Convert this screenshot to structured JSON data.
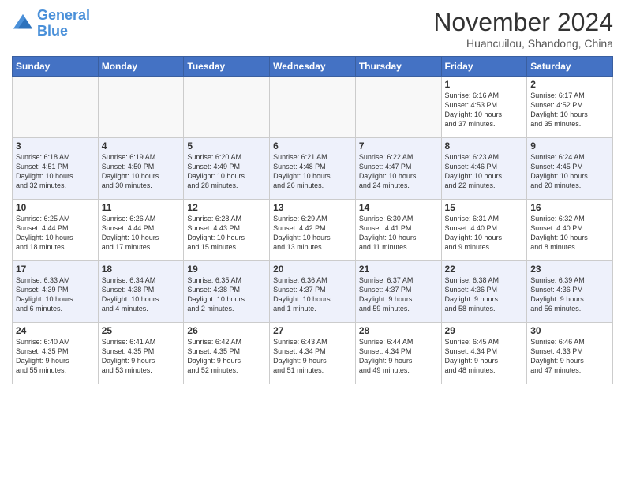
{
  "header": {
    "logo_line1": "General",
    "logo_line2": "Blue",
    "month_title": "November 2024",
    "subtitle": "Huancuilou, Shandong, China"
  },
  "days_of_week": [
    "Sunday",
    "Monday",
    "Tuesday",
    "Wednesday",
    "Thursday",
    "Friday",
    "Saturday"
  ],
  "weeks": [
    [
      {
        "day": "",
        "info": ""
      },
      {
        "day": "",
        "info": ""
      },
      {
        "day": "",
        "info": ""
      },
      {
        "day": "",
        "info": ""
      },
      {
        "day": "",
        "info": ""
      },
      {
        "day": "1",
        "info": "Sunrise: 6:16 AM\nSunset: 4:53 PM\nDaylight: 10 hours\nand 37 minutes."
      },
      {
        "day": "2",
        "info": "Sunrise: 6:17 AM\nSunset: 4:52 PM\nDaylight: 10 hours\nand 35 minutes."
      }
    ],
    [
      {
        "day": "3",
        "info": "Sunrise: 6:18 AM\nSunset: 4:51 PM\nDaylight: 10 hours\nand 32 minutes."
      },
      {
        "day": "4",
        "info": "Sunrise: 6:19 AM\nSunset: 4:50 PM\nDaylight: 10 hours\nand 30 minutes."
      },
      {
        "day": "5",
        "info": "Sunrise: 6:20 AM\nSunset: 4:49 PM\nDaylight: 10 hours\nand 28 minutes."
      },
      {
        "day": "6",
        "info": "Sunrise: 6:21 AM\nSunset: 4:48 PM\nDaylight: 10 hours\nand 26 minutes."
      },
      {
        "day": "7",
        "info": "Sunrise: 6:22 AM\nSunset: 4:47 PM\nDaylight: 10 hours\nand 24 minutes."
      },
      {
        "day": "8",
        "info": "Sunrise: 6:23 AM\nSunset: 4:46 PM\nDaylight: 10 hours\nand 22 minutes."
      },
      {
        "day": "9",
        "info": "Sunrise: 6:24 AM\nSunset: 4:45 PM\nDaylight: 10 hours\nand 20 minutes."
      }
    ],
    [
      {
        "day": "10",
        "info": "Sunrise: 6:25 AM\nSunset: 4:44 PM\nDaylight: 10 hours\nand 18 minutes."
      },
      {
        "day": "11",
        "info": "Sunrise: 6:26 AM\nSunset: 4:44 PM\nDaylight: 10 hours\nand 17 minutes."
      },
      {
        "day": "12",
        "info": "Sunrise: 6:28 AM\nSunset: 4:43 PM\nDaylight: 10 hours\nand 15 minutes."
      },
      {
        "day": "13",
        "info": "Sunrise: 6:29 AM\nSunset: 4:42 PM\nDaylight: 10 hours\nand 13 minutes."
      },
      {
        "day": "14",
        "info": "Sunrise: 6:30 AM\nSunset: 4:41 PM\nDaylight: 10 hours\nand 11 minutes."
      },
      {
        "day": "15",
        "info": "Sunrise: 6:31 AM\nSunset: 4:40 PM\nDaylight: 10 hours\nand 9 minutes."
      },
      {
        "day": "16",
        "info": "Sunrise: 6:32 AM\nSunset: 4:40 PM\nDaylight: 10 hours\nand 8 minutes."
      }
    ],
    [
      {
        "day": "17",
        "info": "Sunrise: 6:33 AM\nSunset: 4:39 PM\nDaylight: 10 hours\nand 6 minutes."
      },
      {
        "day": "18",
        "info": "Sunrise: 6:34 AM\nSunset: 4:38 PM\nDaylight: 10 hours\nand 4 minutes."
      },
      {
        "day": "19",
        "info": "Sunrise: 6:35 AM\nSunset: 4:38 PM\nDaylight: 10 hours\nand 2 minutes."
      },
      {
        "day": "20",
        "info": "Sunrise: 6:36 AM\nSunset: 4:37 PM\nDaylight: 10 hours\nand 1 minute."
      },
      {
        "day": "21",
        "info": "Sunrise: 6:37 AM\nSunset: 4:37 PM\nDaylight: 9 hours\nand 59 minutes."
      },
      {
        "day": "22",
        "info": "Sunrise: 6:38 AM\nSunset: 4:36 PM\nDaylight: 9 hours\nand 58 minutes."
      },
      {
        "day": "23",
        "info": "Sunrise: 6:39 AM\nSunset: 4:36 PM\nDaylight: 9 hours\nand 56 minutes."
      }
    ],
    [
      {
        "day": "24",
        "info": "Sunrise: 6:40 AM\nSunset: 4:35 PM\nDaylight: 9 hours\nand 55 minutes."
      },
      {
        "day": "25",
        "info": "Sunrise: 6:41 AM\nSunset: 4:35 PM\nDaylight: 9 hours\nand 53 minutes."
      },
      {
        "day": "26",
        "info": "Sunrise: 6:42 AM\nSunset: 4:35 PM\nDaylight: 9 hours\nand 52 minutes."
      },
      {
        "day": "27",
        "info": "Sunrise: 6:43 AM\nSunset: 4:34 PM\nDaylight: 9 hours\nand 51 minutes."
      },
      {
        "day": "28",
        "info": "Sunrise: 6:44 AM\nSunset: 4:34 PM\nDaylight: 9 hours\nand 49 minutes."
      },
      {
        "day": "29",
        "info": "Sunrise: 6:45 AM\nSunset: 4:34 PM\nDaylight: 9 hours\nand 48 minutes."
      },
      {
        "day": "30",
        "info": "Sunrise: 6:46 AM\nSunset: 4:33 PM\nDaylight: 9 hours\nand 47 minutes."
      }
    ]
  ]
}
